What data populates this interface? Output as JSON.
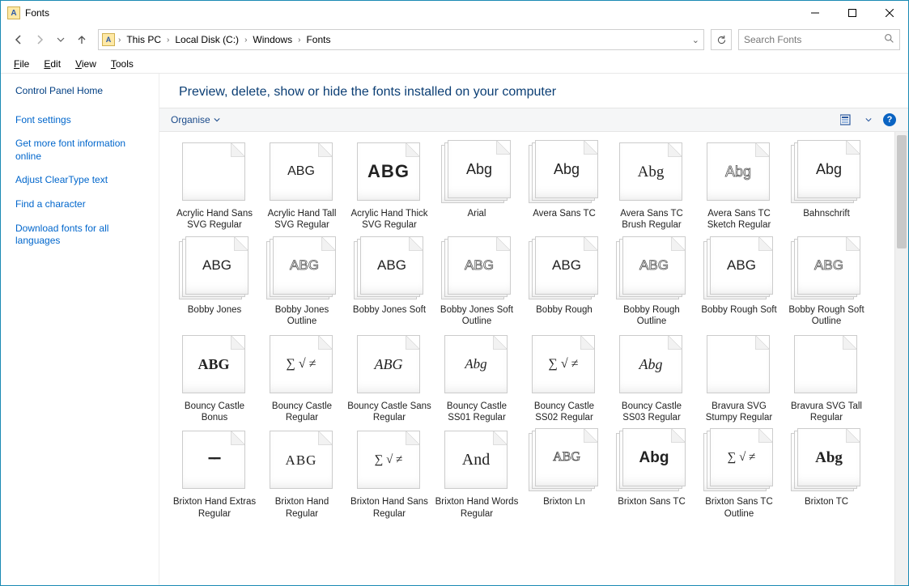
{
  "window": {
    "title": "Fonts"
  },
  "breadcrumbs": [
    "This PC",
    "Local Disk (C:)",
    "Windows",
    "Fonts"
  ],
  "search": {
    "placeholder": "Search Fonts"
  },
  "menu": {
    "file": "File",
    "edit": "Edit",
    "view": "View",
    "tools": "Tools"
  },
  "sidebar": {
    "home": "Control Panel Home",
    "links": [
      "Font settings",
      "Get more font information online",
      "Adjust ClearType text",
      "Find a character",
      "Download fonts for all languages"
    ]
  },
  "page_heading": "Preview, delete, show or hide the fonts installed on your computer",
  "toolbar": {
    "organise": "Organise",
    "help": "?"
  },
  "fonts": [
    {
      "label": "Acrylic Hand Sans SVG Regular",
      "sample": "",
      "stack": false,
      "style": ""
    },
    {
      "label": "Acrylic Hand Tall SVG Regular",
      "sample": "ABG",
      "stack": false,
      "style": "font-family:'Arial Narrow',sans-serif;font-size:16px;"
    },
    {
      "label": "Acrylic Hand Thick SVG Regular",
      "sample": "ABG",
      "stack": false,
      "style": "font-family:Impact,Arial Black,sans-serif;font-weight:900;font-size:22px;letter-spacing:1px;"
    },
    {
      "label": "Arial",
      "sample": "Abg",
      "stack": true,
      "style": "font-family:Arial,sans-serif;"
    },
    {
      "label": "Avera Sans TC",
      "sample": "Abg",
      "stack": true,
      "style": "font-family:Arial,sans-serif;"
    },
    {
      "label": "Avera Sans TC Brush Regular",
      "sample": "Abg",
      "stack": false,
      "style": "font-family:'Segoe Script',cursive;font-size:19px;"
    },
    {
      "label": "Avera Sans TC Sketch Regular",
      "sample": "Abg",
      "stack": false,
      "style": "font-family:Arial,sans-serif;",
      "outline": true
    },
    {
      "label": "Bahnschrift",
      "sample": "Abg",
      "stack": true,
      "style": "font-family:Bahnschrift,Arial,sans-serif;"
    },
    {
      "label": "Bobby Jones",
      "sample": "ABG",
      "stack": true,
      "style": "font-family:'Arial Black',sans-serif;font-size:17px;"
    },
    {
      "label": "Bobby Jones Outline",
      "sample": "ABG",
      "stack": true,
      "style": "font-family:'Arial Black',sans-serif;font-size:17px;",
      "outline": true
    },
    {
      "label": "Bobby Jones Soft",
      "sample": "ABG",
      "stack": true,
      "style": "font-family:'Arial Black',sans-serif;font-size:17px;"
    },
    {
      "label": "Bobby Jones Soft Outline",
      "sample": "ABG",
      "stack": true,
      "style": "font-family:'Arial Black',sans-serif;font-size:17px;",
      "outline": true
    },
    {
      "label": "Bobby Rough",
      "sample": "ABG",
      "stack": true,
      "style": "font-family:'Arial Black',sans-serif;font-size:17px;"
    },
    {
      "label": "Bobby Rough Outline",
      "sample": "ABG",
      "stack": true,
      "style": "font-family:'Arial Black',sans-serif;font-size:17px;",
      "outline": true
    },
    {
      "label": "Bobby Rough Soft",
      "sample": "ABG",
      "stack": true,
      "style": "font-family:'Arial Black',sans-serif;font-size:17px;"
    },
    {
      "label": "Bobby Rough Soft Outline",
      "sample": "ABG",
      "stack": true,
      "style": "font-family:'Arial Black',sans-serif;font-size:17px;",
      "outline": true
    },
    {
      "label": "Bouncy Castle Bonus",
      "sample": "ABG",
      "stack": false,
      "style": "font-family:Georgia,serif;font-weight:bold;font-size:18px;"
    },
    {
      "label": "Bouncy Castle Regular",
      "sample": "∑ √ ≠",
      "stack": false,
      "style": "font-family:'Times New Roman',serif;font-size:16px;"
    },
    {
      "label": "Bouncy Castle Sans Regular",
      "sample": "ABG",
      "stack": false,
      "style": "font-family:'Brush Script MT',cursive;font-style:italic;font-size:18px;"
    },
    {
      "label": "Bouncy Castle SS01 Regular",
      "sample": "Abg",
      "stack": false,
      "style": "font-family:'Segoe Script',cursive;font-style:italic;font-size:17px;"
    },
    {
      "label": "Bouncy Castle SS02 Regular",
      "sample": "∑ √ ≠",
      "stack": false,
      "style": "font-family:'Times New Roman',serif;font-size:16px;"
    },
    {
      "label": "Bouncy Castle SS03 Regular",
      "sample": "Abg",
      "stack": false,
      "style": "font-family:'Brush Script MT',cursive;font-style:italic;font-size:18px;"
    },
    {
      "label": "Bravura SVG Stumpy Regular",
      "sample": "",
      "stack": false,
      "style": ""
    },
    {
      "label": "Bravura SVG Tall Regular",
      "sample": "",
      "stack": false,
      "style": ""
    },
    {
      "label": "Brixton Hand Extras Regular",
      "sample": "━━",
      "stack": false,
      "style": "font-family:serif;font-size:14px;letter-spacing:-2px;"
    },
    {
      "label": "Brixton Hand Regular",
      "sample": "ABG",
      "stack": false,
      "style": "font-family:'Palatino Linotype',serif;font-size:17px;letter-spacing:1px;"
    },
    {
      "label": "Brixton Hand Sans Regular",
      "sample": "∑ √ ≠",
      "stack": false,
      "style": "font-family:'Times New Roman',serif;font-size:15px;"
    },
    {
      "label": "Brixton Hand Words Regular",
      "sample": "And",
      "stack": false,
      "style": "font-family:'Brush Script MT',cursive;font-size:20px;"
    },
    {
      "label": "Brixton Ln",
      "sample": "ABG",
      "stack": true,
      "style": "font-family:'Palatino Linotype',serif;font-size:16px;",
      "outline": true
    },
    {
      "label": "Brixton Sans TC",
      "sample": "Abg",
      "stack": true,
      "style": "font-family:Arial,sans-serif;font-weight:bold;font-size:19px;"
    },
    {
      "label": "Brixton Sans TC Outline",
      "sample": "∑ √ ≠",
      "stack": true,
      "style": "font-family:'Times New Roman',serif;font-size:15px;"
    },
    {
      "label": "Brixton TC",
      "sample": "Abg",
      "stack": true,
      "style": "font-family:Georgia,serif;font-weight:bold;font-size:19px;"
    }
  ]
}
